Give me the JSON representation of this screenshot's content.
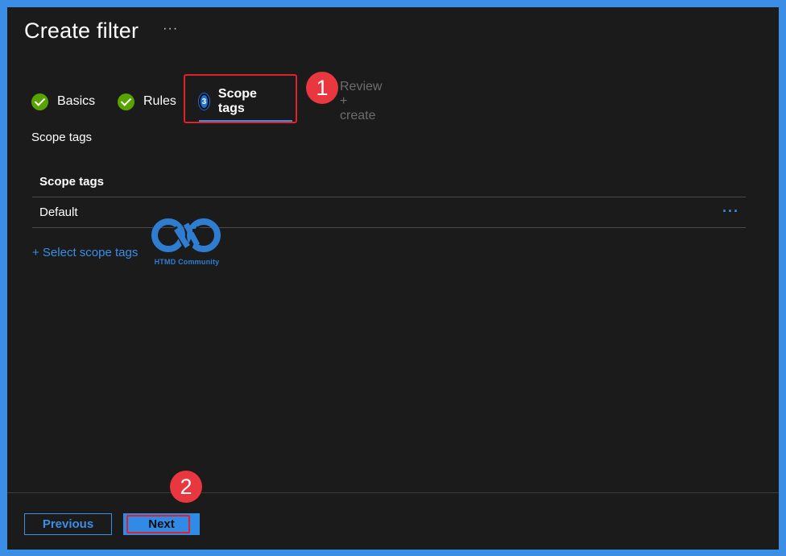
{
  "header": {
    "title": "Create filter",
    "more_label": "···"
  },
  "wizard": {
    "steps": [
      {
        "label": "Basics",
        "state": "completed"
      },
      {
        "label": "Rules",
        "state": "completed"
      },
      {
        "label": "Scope tags",
        "state": "active",
        "number": "3"
      },
      {
        "label": "Review + create",
        "state": "disabled"
      }
    ]
  },
  "callouts": {
    "one": "1",
    "two": "2"
  },
  "section": {
    "label": "Scope tags"
  },
  "table": {
    "header": "Scope tags",
    "rows": [
      {
        "name": "Default",
        "more_label": "···"
      }
    ]
  },
  "actions": {
    "select_link": "+ Select scope tags"
  },
  "watermark": {
    "text": "HTMD Community"
  },
  "footer": {
    "previous_label": "Previous",
    "next_label": "Next"
  },
  "colors": {
    "accent": "#3a8ee6",
    "success": "#57a300",
    "callout": "#e8373f",
    "highlight": "#e0202a",
    "background": "#1b1b1b"
  }
}
